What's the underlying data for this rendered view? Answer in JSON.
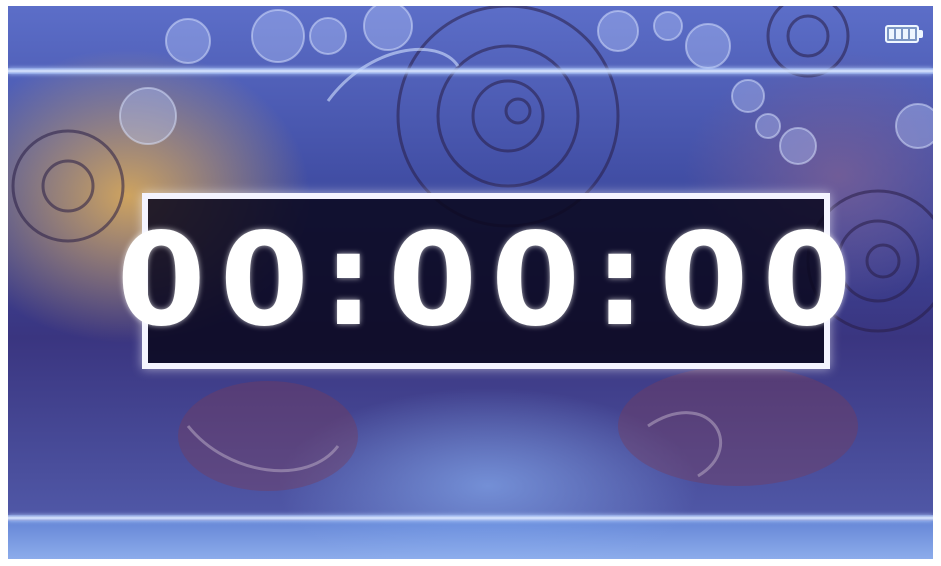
{
  "timer": {
    "display": "00:00:00"
  },
  "status": {
    "battery_icon": "battery-full-icon",
    "battery_level": 1.0
  },
  "colors": {
    "timer_text": "#ffffff",
    "timer_border": "#f4f4ff",
    "timer_background": "#0a081e",
    "divider_lines": "#d9e6ff"
  }
}
